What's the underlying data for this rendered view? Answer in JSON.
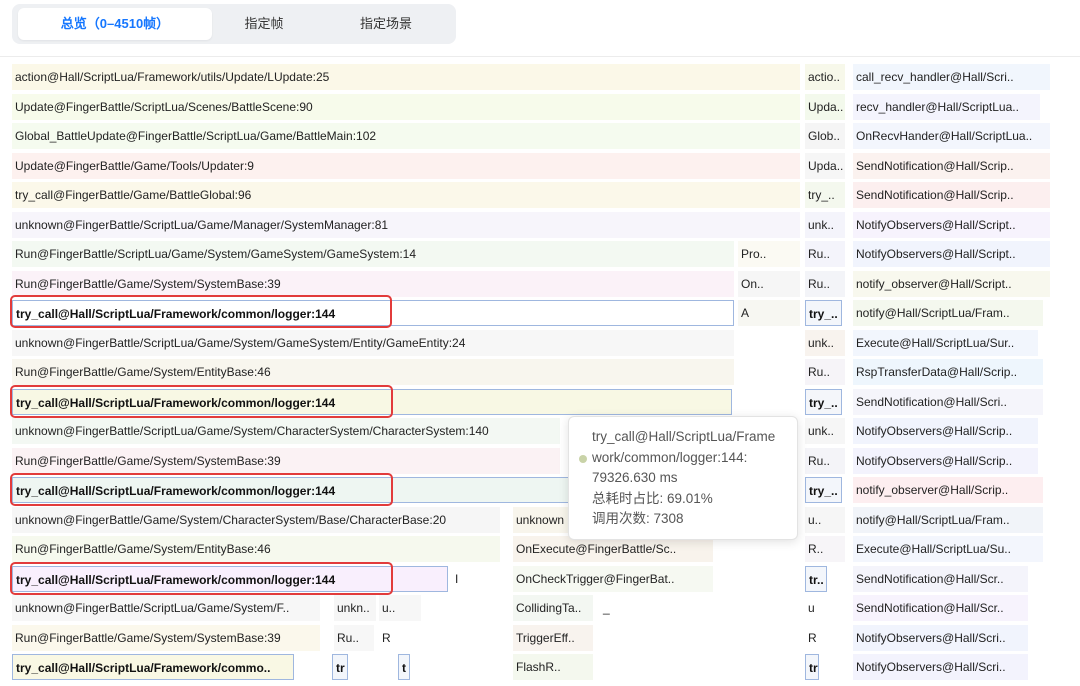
{
  "tabs": [
    {
      "label": "总览（0–4510帧）"
    },
    {
      "label": "指定帧"
    },
    {
      "label": "指定场景"
    }
  ],
  "rows": [
    {
      "c": [
        {
          "t": "action@Hall/ScriptLua/Framework/utils/Update/LUpdate:25",
          "bg": "#fbf8e8"
        },
        {
          "t": "actio..",
          "bg": "#f7f8ea"
        },
        {
          "t": "call_recv_handler@Hall/Scri..",
          "bg": "#f1f6fd"
        }
      ]
    },
    {
      "c": [
        {
          "t": "Update@FingerBattle/ScriptLua/Scenes/BattleScene:90",
          "bg": "#f7fbeb"
        },
        {
          "t": "Upda..",
          "bg": "#f3f9ec"
        },
        {
          "t": "recv_handler@Hall/ScriptLua..",
          "bg": "#f4f4fd"
        }
      ]
    },
    {
      "c": [
        {
          "t": "Global_BattleUpdate@FingerBattle/ScriptLua/Game/BattleMain:102",
          "bg": "#f5fbef"
        },
        {
          "t": "Glob..",
          "bg": "#f5f5f5"
        },
        {
          "t": "OnRecvHander@Hall/ScriptLua..",
          "bg": "#f3f6fd"
        }
      ]
    },
    {
      "c": [
        {
          "t": "Update@FingerBattle/Game/Tools/Updater:9",
          "bg": "#fdf1ef"
        },
        {
          "t": "Upda..",
          "bg": "#f6f6f6"
        },
        {
          "t": "SendNotification@Hall/Scrip..",
          "bg": "#fbf2ef"
        }
      ]
    },
    {
      "c": [
        {
          "t": "try_call@FingerBattle/Game/BattleGlobal:96",
          "bg": "#fbf8ea"
        },
        {
          "t": "try_..",
          "bg": "#f4f8ee"
        },
        {
          "t": "SendNotification@Hall/Scrip..",
          "bg": "#fcefef"
        }
      ]
    },
    {
      "c": [
        {
          "t": "unknown@FingerBattle/ScriptLua/Game/Manager/SystemManager:81",
          "bg": "#f7f5fb"
        },
        {
          "t": "unk..",
          "bg": "#f4f4fb"
        },
        {
          "t": "NotifyObservers@Hall/Script..",
          "bg": "#f7f3fd"
        }
      ]
    },
    {
      "c": [
        {
          "t": "Run@FingerBattle/ScriptLua/Game/System/GameSystem/GameSystem:14",
          "bg": "#f3f9f2"
        },
        {
          "t": "Pro..",
          "bg": "#fbfaf3"
        },
        {
          "t": "Ru..",
          "bg": "#f4f4fb"
        },
        {
          "t": "NotifyObservers@Hall/Script..",
          "bg": "#f1f4fd"
        }
      ]
    },
    {
      "c": [
        {
          "t": "Run@FingerBattle/Game/System/SystemBase:39",
          "bg": "#fbf2f8"
        },
        {
          "t": "On..",
          "bg": "#f6f6f6"
        },
        {
          "t": "Ru..",
          "bg": "#f3f4f8"
        },
        {
          "t": "notify_observer@Hall/Script..",
          "bg": "#f8f8ee"
        }
      ]
    },
    {
      "c": [
        {
          "t": "try_call@Hall/ScriptLua/Framework/common/logger:144",
          "bg": "#ffffff",
          "hl": true
        },
        {
          "t": "A",
          "bg": "#f7f7f2"
        },
        {
          "t": "try_..",
          "bg": "#f3f6fb",
          "hl": true
        },
        {
          "t": "notify@Hall/ScriptLua/Fram..",
          "bg": "#f4f8ee"
        }
      ]
    },
    {
      "c": [
        {
          "t": "unknown@FingerBattle/ScriptLua/Game/System/GameSystem/Entity/GameEntity:24",
          "bg": "#f7f7f7"
        },
        {
          "t": "unk..",
          "bg": "#f8f3ee"
        },
        {
          "t": "Execute@Hall/ScriptLua/Sur..",
          "bg": "#f2f6fd"
        }
      ]
    },
    {
      "c": [
        {
          "t": "Run@FingerBattle/Game/System/EntityBase:46",
          "bg": "#f8f6ee"
        },
        {
          "t": "Ru..",
          "bg": "#f6f4f8"
        },
        {
          "t": "RspTransferData@Hall/Scrip..",
          "bg": "#eef6fd"
        }
      ]
    },
    {
      "c": [
        {
          "t": "try_call@Hall/ScriptLua/Framework/common/logger:144",
          "bg": "#f8f8e4",
          "hl": true
        },
        {
          "t": "try_..",
          "bg": "#f4f6fa",
          "hl": true
        },
        {
          "t": "SendNotification@Hall/Scri..",
          "bg": "#f5f5fb"
        }
      ]
    },
    {
      "c": [
        {
          "t": "unknown@FingerBattle/ScriptLua/Game/System/CharacterSystem/CharacterSystem:140",
          "bg": "#f3f8f3"
        },
        {
          "t": "unk..",
          "bg": "#f6f6f6"
        },
        {
          "t": "NotifyObservers@Hall/Scrip..",
          "bg": "#f1f4fd"
        }
      ]
    },
    {
      "c": [
        {
          "t": "Run@FingerBattle/Game/System/SystemBase:39",
          "bg": "#fbf2f4"
        },
        {
          "t": "Ru..",
          "bg": "#f4f4f8"
        },
        {
          "t": "NotifyObservers@Hall/Scrip..",
          "bg": "#f3f3fd"
        }
      ]
    },
    {
      "c": [
        {
          "t": "try_call@Hall/ScriptLua/Framework/common/logger:144",
          "bg": "#eef6f2",
          "hl": true
        },
        {
          "t": "try_..",
          "bg": "#f3f6fb",
          "hl": true
        },
        {
          "t": "notify_observer@Hall/Scrip..",
          "bg": "#fdeef0"
        }
      ]
    },
    {
      "c": [
        {
          "t": "unknown@FingerBattle/Game/System/CharacterSystem/Base/CharacterBase:20",
          "bg": "#f6f6f6"
        },
        {
          "t": "unknown",
          "bg": "#f8f5ec"
        },
        {
          "t": "u..",
          "bg": "#f6f6f6"
        },
        {
          "t": "notify@Hall/ScriptLua/Fram..",
          "bg": "#f1f4f9"
        }
      ]
    },
    {
      "c": [
        {
          "t": "Run@FingerBattle/Game/System/EntityBase:46",
          "bg": "#f6f9ee"
        },
        {
          "t": "OnExecute@FingerBattle/Sc..",
          "bg": "#f8f3ec"
        },
        {
          "t": "R..",
          "bg": "#f7f5f8"
        },
        {
          "t": "Execute@Hall/ScriptLua/Su..",
          "bg": "#f3f6fd"
        }
      ]
    },
    {
      "c": [
        {
          "t": "try_call@Hall/ScriptLua/Framework/common/logger:144",
          "bg": "#f9effd",
          "hl": true
        },
        {
          "t": "I",
          "bg": "#ffffff"
        },
        {
          "t": "OnCheckTrigger@FingerBat..",
          "bg": "#f6f9f2"
        },
        {
          "t": "tr..",
          "bg": "#f3f6fb",
          "hl": true
        },
        {
          "t": "SendNotification@Hall/Scr..",
          "bg": "#f4f4fb"
        }
      ]
    },
    {
      "c": [
        {
          "t": "unknown@FingerBattle/ScriptLua/Game/System/F..",
          "bg": "#f7f7f7"
        },
        {
          "t": "unkn..",
          "bg": "#f6f6f6"
        },
        {
          "t": "u..",
          "bg": "#f7f7f7"
        },
        {
          "t": "CollidingTa..",
          "bg": "#f3f7f2"
        },
        {
          "t": "_",
          "bg": "#ffffff"
        },
        {
          "t": "u",
          "bg": "#ffffff"
        },
        {
          "t": "SendNotification@Hall/Scr..",
          "bg": "#f7f3fd"
        }
      ]
    },
    {
      "c": [
        {
          "t": "Run@FingerBattle/Game/System/SystemBase:39",
          "bg": "#fbf8ec"
        },
        {
          "t": "Ru..",
          "bg": "#f7f7f7"
        },
        {
          "t": "R",
          "bg": "#ffffff"
        },
        {
          "t": "TriggerEff..",
          "bg": "#f8f3ee"
        },
        {
          "t": "R",
          "bg": "#ffffff"
        },
        {
          "t": "NotifyObservers@Hall/Scri..",
          "bg": "#f1f4fd"
        }
      ]
    },
    {
      "c": [
        {
          "t": "try_call@Hall/ScriptLua/Framework/commo..",
          "bg": "#f9f8e4",
          "hl": true
        },
        {
          "t": "tr",
          "bg": "#f3f6fb",
          "hl": true
        },
        {
          "t": "t",
          "bg": "#f3f6fb",
          "hl": true
        },
        {
          "t": "FlashR..",
          "bg": "#f4f8ee"
        },
        {
          "t": "tr",
          "bg": "#f3f6fb",
          "hl": true
        },
        {
          "t": "NotifyObservers@Hall/Scri..",
          "bg": "#f3f3fd"
        }
      ]
    }
  ],
  "tooltip": {
    "line1": "try_call@Hall/ScriptLua/Frame",
    "line2": "work/common/logger:144:",
    "line3": "79326.630 ms",
    "line4": "总耗时占比: 69.01%",
    "line5": "调用次数: 7308"
  }
}
